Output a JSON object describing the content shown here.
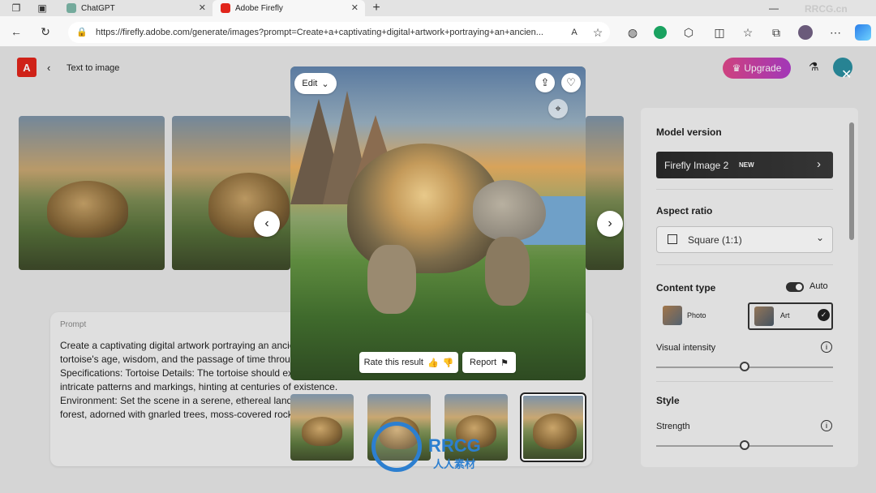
{
  "browser": {
    "tabs": [
      {
        "label": "ChatGPT",
        "active": false
      },
      {
        "label": "Adobe Firefly",
        "active": true
      }
    ],
    "url": "https://firefly.adobe.com/generate/images?prompt=Create+a+captivating+digital+artwork+portraying+an+ancien..."
  },
  "header": {
    "back_label": "Text to image",
    "upgrade_label": "Upgrade"
  },
  "modal": {
    "edit_label": "Edit",
    "rate_label": "Rate this result",
    "report_label": "Report"
  },
  "prompt": {
    "label": "Prompt",
    "lines": [
      "Create a captivating digital artwork portraying an ancien",
      "tortoise's age, wisdom, and the passage of time through",
      "Specifications: Tortoise Details: The tortoise should exud",
      "intricate patterns and markings, hinting at centuries of existence.",
      "Environment: Set the scene in a serene, ethereal landsca",
      "forest, adorned with gnarled trees, moss-covered rocks,"
    ]
  },
  "panel": {
    "model_version_label": "Model version",
    "model_name": "Firefly Image 2",
    "model_badge": "NEW",
    "aspect_ratio_label": "Aspect ratio",
    "aspect_value": "Square (1:1)",
    "content_type_label": "Content type",
    "auto_label": "Auto",
    "photo_label": "Photo",
    "art_label": "Art",
    "visual_intensity_label": "Visual intensity",
    "visual_intensity_value": 0.5,
    "style_label": "Style",
    "strength_label": "Strength",
    "strength_value": 0.5
  },
  "watermark": {
    "brand": "RRCG",
    "sub": "人人素材",
    "corner": "RRCG.cn"
  },
  "colors": {
    "accent": "#e0488a",
    "adobe_red": "#e1251b",
    "close": "#ffffff"
  }
}
